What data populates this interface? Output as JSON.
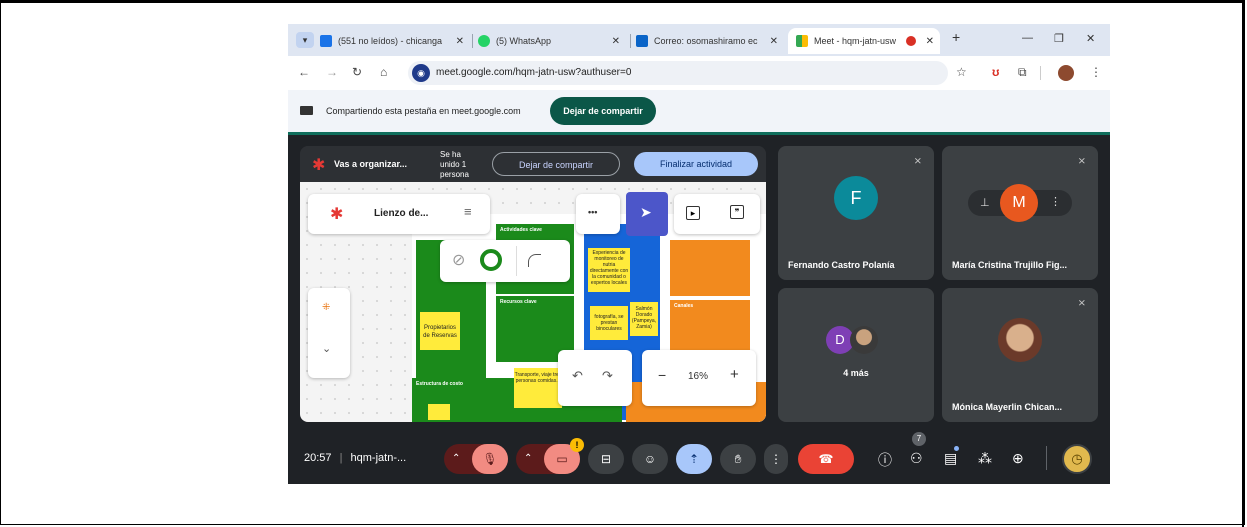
{
  "tabs": [
    {
      "title": "(551 no leídos) - chicanga",
      "icon": "gmail-icon"
    },
    {
      "title": "(5) WhatsApp",
      "icon": "whatsapp-icon"
    },
    {
      "title": "Correo: osomashiramo ec",
      "icon": "outlook-icon"
    },
    {
      "title": "Meet - hqm-jatn-usw",
      "icon": "meet-icon"
    }
  ],
  "new_tab": "+",
  "url": "meet.google.com/hqm-jatn-usw?authuser=0",
  "share_banner": {
    "text": "Compartiendo esta pestaña en meet.google.com",
    "button": "Dejar de compartir"
  },
  "presentation_bar": {
    "title": "Vas a organizar...",
    "joined": "Se ha unido 1 persona",
    "stop": "Dejar de compartir",
    "end": "Finalizar actividad"
  },
  "whiteboard": {
    "board_title": "Lienzo de...",
    "more": "•••",
    "zoom": "16%",
    "minus": "−",
    "plus": "+",
    "sections": {
      "activities": "Actividades clave",
      "resources": "Recursos clave",
      "channels": "Canales",
      "costs": "Estructura de costo"
    },
    "notes": {
      "reserves": "Propietarios de Reservas",
      "experience": "Experiencia de monitoreo de nutria directamente con la comunidad o expertos locales",
      "photo": "fotografía, se prestan binoculares",
      "salmon": "Salmón Dorado (Pampeya, Zamia)",
      "transport": "Transporte, viaje tres personas comidas..."
    }
  },
  "participants": [
    {
      "name": "Fernando Castro Polanía",
      "initial": "F",
      "color": "#0b8a9a"
    },
    {
      "name": "María Cristina Trujillo Fig...",
      "initial": "M",
      "color": "#e8581f"
    },
    {
      "name": "4 más",
      "initial": "D",
      "color": "#7e3fb5"
    },
    {
      "name": "Mónica Mayerlin Chican..."
    }
  ],
  "meeting": {
    "time": "20:57",
    "code": "hqm-jatn-...",
    "separator": "|",
    "people_count": "7",
    "alert": "!"
  }
}
